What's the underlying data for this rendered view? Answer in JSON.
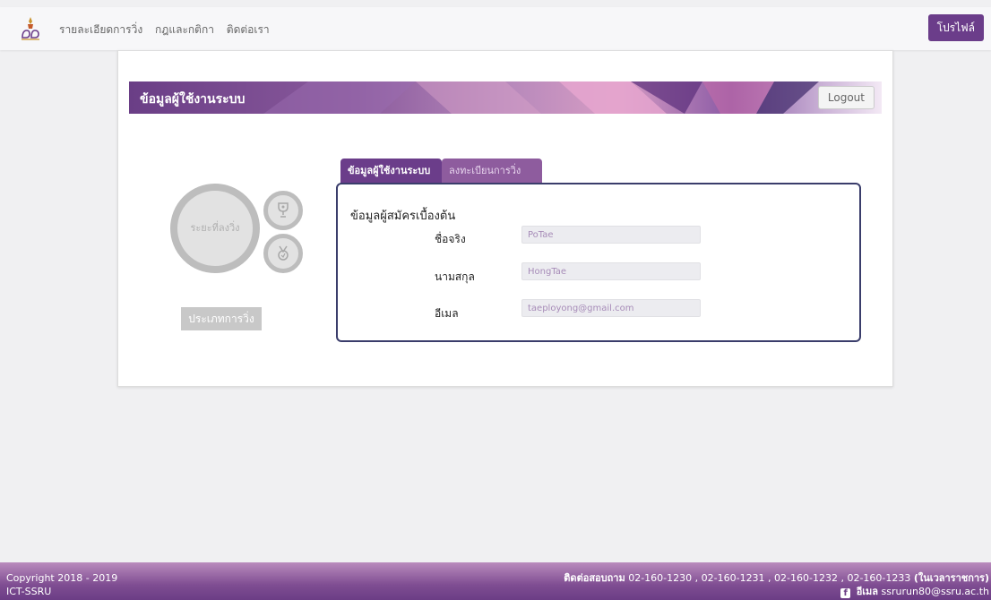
{
  "nav": {
    "links": [
      "รายละเอียดการวิ่ง",
      "กฎและกติกา",
      "ติดต่อเรา"
    ],
    "profile_label": "โปรไฟล์"
  },
  "banner": {
    "title": "ข้อมูลผู้ใช้งานระบบ",
    "logout_label": "Logout"
  },
  "left_panel": {
    "distance_label": "ระยะที่ลงวิ่ง",
    "type_button": "ประเภทการวิ่ง"
  },
  "tabs": [
    "ข้อมูลผู้ใช้งานระบบ",
    "ลงทะเบียนการวิ่ง"
  ],
  "form": {
    "heading": "ข้อมูลผู้สมัครเบื้องต้น",
    "fields": [
      {
        "label": "ชื่อจริง",
        "value": "PoTae"
      },
      {
        "label": "นามสกุล",
        "value": "HongTae"
      },
      {
        "label": "อีเมล",
        "value": "taeployong@gmail.com"
      }
    ]
  },
  "footer": {
    "copyright": "Copyright 2018 - 2019",
    "org": "ICT-SSRU",
    "contact_label": "ติดต่อสอบถาม",
    "contact_numbers": "02-160-1230 , 02-160-1231 , 02-160-1232 , 02-160-1233",
    "contact_hours": "(ในเวลาราชการ)",
    "email_label": "อีเมล",
    "email": "ssrurun80@ssru.ac.th"
  },
  "colors": {
    "brand_purple": "#6b3d8a",
    "form_border": "#3a3d6b"
  }
}
